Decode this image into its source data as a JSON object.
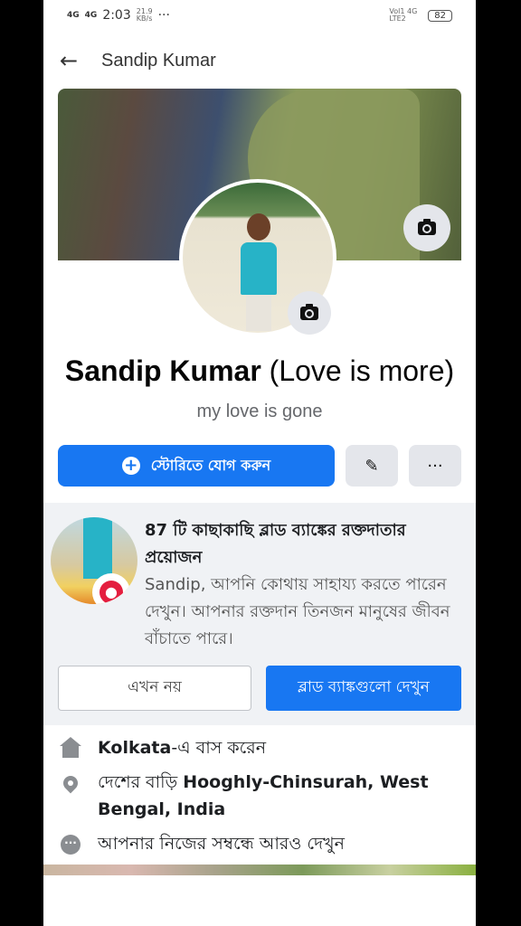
{
  "status": {
    "signal1": "4G",
    "signal2": "4G",
    "time": "2:03",
    "speed": "21.9",
    "speed_unit": "KB/s",
    "more": "···",
    "volte": "Vol1 4G",
    "lte": "LTE2",
    "battery": "82"
  },
  "appbar": {
    "title": "Sandip Kumar",
    "back_icon": "arrow-left-icon"
  },
  "profile": {
    "name": "Sandip Kumar",
    "name_suffix": " (Love is more)",
    "bio": "my love is gone"
  },
  "actions": {
    "add_story": "স্টোরিতে যোগ করুন",
    "edit_icon": "✎",
    "more_icon": "···"
  },
  "blood_card": {
    "heading": "87 টি কাছাকাছি ব্লাড ব্যাঙ্কের রক্তদাতার প্রয়োজন",
    "body": "Sandip, আপনি কোথায় সাহায্য করতে পারেন দেখুন। আপনার রক্তদান তিনজন মানুষের জীবন বাঁচাতে পারে।",
    "not_now": "এখন নয়",
    "see_banks": "ব্লাড ব্যাঙ্কগুলো দেখুন"
  },
  "info": {
    "lives_city": "Kolkata",
    "lives_suffix": "-এ বাস করেন",
    "home_prefix": "দেশের বাড়ি ",
    "home_place": "Hooghly-Chinsurah, West Bengal, India",
    "see_more": "আপনার নিজের সম্বন্ধে আরও দেখুন"
  }
}
